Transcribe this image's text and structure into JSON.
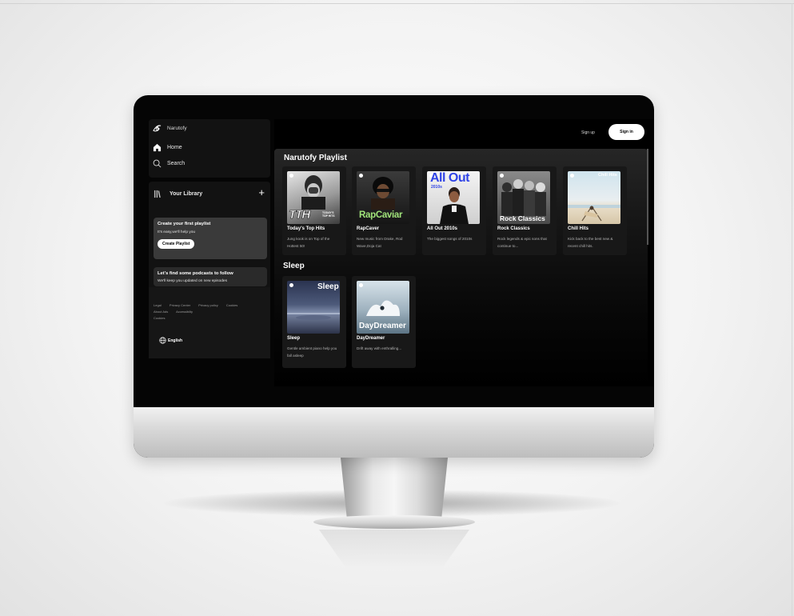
{
  "app": {
    "brand": "Narutofy"
  },
  "nav": {
    "home": "Home",
    "search": "Search"
  },
  "library": {
    "title": "Your Library",
    "add_label": "+",
    "promo_playlist": {
      "title": "Create your first playlist",
      "text": "It's easy,we'll help you",
      "button": "Create Playlist"
    },
    "promo_podcast": {
      "title": "Let's find some podcasts to follow",
      "text": "We'll keep you updated on new episodes"
    },
    "legal_links": [
      "Legal",
      "Privacy Center",
      "Privacy policy",
      "Cookies",
      "About Ads",
      "Accessibilty",
      "Cookies"
    ],
    "language": "English"
  },
  "header": {
    "signup": "Sign up",
    "signin": "Sign in"
  },
  "sections": [
    {
      "title": "Narutofy Playlist",
      "cards": [
        {
          "title": "Today's Top Hits",
          "desc": "Jung kook is on Top of the Hottest 50!",
          "cover_text": "TTH",
          "cover_sub": "TODAY'S TOP HITS"
        },
        {
          "title": "RapCaver",
          "desc": "New music from Drake, Rod Wave,Doja Cat",
          "cover_text": "RapCaviar"
        },
        {
          "title": "All Out 2010s",
          "desc": "The biggest songs of 2010s",
          "cover_text": "All Out",
          "cover_sub": "2010s"
        },
        {
          "title": "Rock Classics",
          "desc": "Rock legends & epic sons that continue to...",
          "cover_text": "Rock Classics"
        },
        {
          "title": "Chill Hits",
          "desc": "Kick back to the best new & recent chill hits.",
          "cover_text": "Chill Hits"
        }
      ]
    },
    {
      "title": "Sleep",
      "cards": [
        {
          "title": "Sleep",
          "desc": "Gentle ambient piano help you fall asleep",
          "cover_text": "Sleep"
        },
        {
          "title": "DayDreamer",
          "desc": "Drift away with enthralling...",
          "cover_text": "DayDreamer"
        }
      ]
    }
  ],
  "colors": {
    "accent_green": "#1db954",
    "rapcaviar_green": "#a0e37a",
    "allout_blue": "#2f43e6"
  }
}
